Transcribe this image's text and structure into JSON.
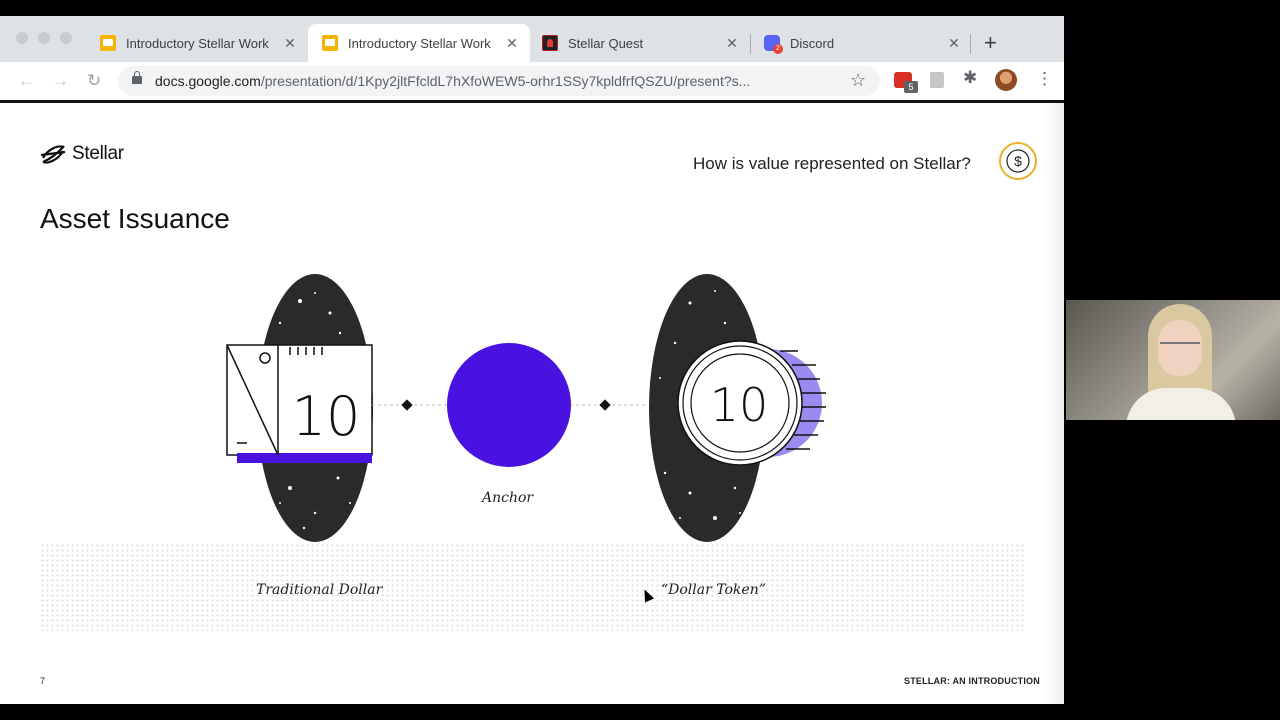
{
  "browser": {
    "tabs": [
      {
        "title": "Introductory Stellar Work",
        "favicon": "slides-icon",
        "active": false
      },
      {
        "title": "Introductory Stellar Work",
        "favicon": "slides-icon",
        "active": true
      },
      {
        "title": "Stellar Quest",
        "favicon": "stellar-quest-icon",
        "active": false
      },
      {
        "title": "Discord",
        "favicon": "discord-icon",
        "active": false
      }
    ],
    "url_domain": "docs.google.com",
    "url_path": "/presentation/d/1Kpy2jltFfcldL7hXfoWEW5-orhr1SSy7kpldfrfQSZU/present?s...",
    "extension_badge": "5"
  },
  "slide": {
    "logo_text": "Stellar",
    "question": "How is value represented on Stellar?",
    "heading": "Asset Issuance",
    "note_value": "10",
    "coin_value": "10",
    "anchor_label": "Anchor",
    "left_caption": "Traditional Dollar",
    "right_caption": "“Dollar Token”",
    "page_number": "7",
    "footer": "STELLAR: AN INTRODUCTION",
    "colors": {
      "accent_purple": "#4a12e0",
      "light_purple": "#9a8bf0",
      "gold": "#e8b12c"
    }
  }
}
